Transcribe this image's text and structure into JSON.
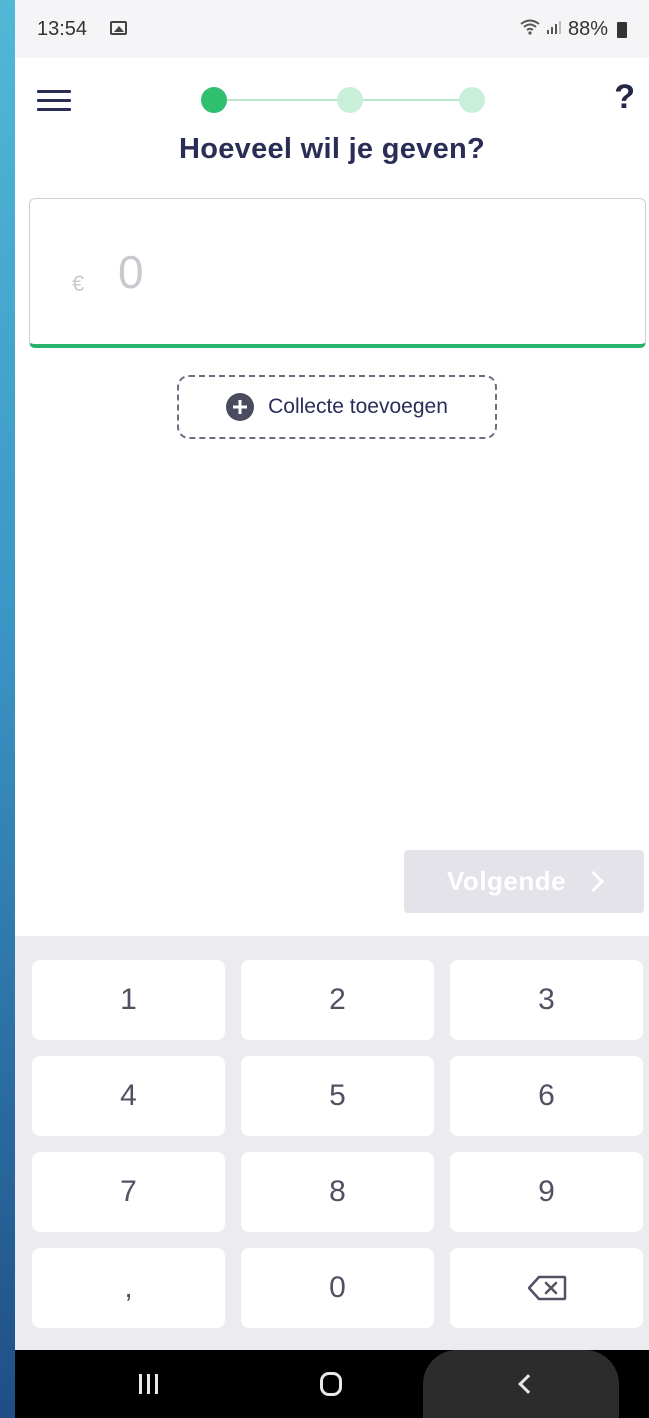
{
  "status_bar": {
    "time": "13:54",
    "signal": "•••│",
    "battery": "88%"
  },
  "header": {
    "title": "Hoeveel wil je geven?",
    "help": "?",
    "steps": {
      "current": 1,
      "total": 3
    }
  },
  "amount": {
    "currency": "€",
    "value": "0"
  },
  "collecte_button": {
    "label": "Collecte toevoegen"
  },
  "next_button": {
    "label": "Volgende",
    "enabled": false
  },
  "keypad": {
    "keys": [
      "1",
      "2",
      "3",
      "4",
      "5",
      "6",
      "7",
      "8",
      "9",
      ",",
      "0",
      "backspace"
    ]
  },
  "colors": {
    "accent": "#2fbf6f",
    "accent_light": "#c9efdb",
    "title": "#2a2d55",
    "disabled": "#e3e3e9"
  }
}
